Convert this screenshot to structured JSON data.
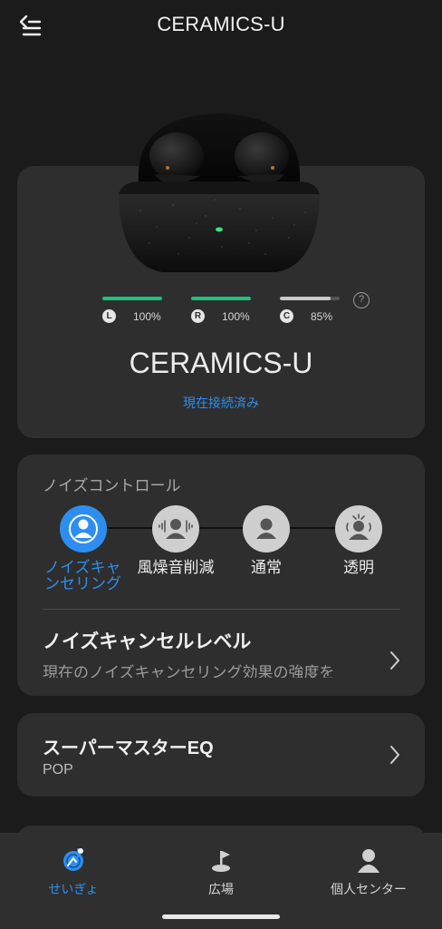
{
  "header": {
    "title": "CERAMICS-U",
    "back_icon": "menu-back-icon"
  },
  "device": {
    "name": "CERAMICS-U",
    "status": "現在接続済み",
    "battery": [
      {
        "badge": "L",
        "percent_label": "100%",
        "level": 1.0,
        "color": "#1fc17a"
      },
      {
        "badge": "R",
        "percent_label": "100%",
        "level": 1.0,
        "color": "#1fc17a"
      },
      {
        "badge": "C",
        "percent_label": "85%",
        "level": 0.85,
        "color": "#c8c8c8"
      }
    ],
    "help_label": "?"
  },
  "noise_control": {
    "title": "ノイズコントロール",
    "modes": [
      {
        "label": "ノイズキャンセリング",
        "icon": "noise-cancel-icon",
        "active": true
      },
      {
        "label": "風燥音削減",
        "icon": "wind-reduction-icon",
        "active": false
      },
      {
        "label": "通常",
        "icon": "normal-icon",
        "active": false
      },
      {
        "label": "透明",
        "icon": "transparency-icon",
        "active": false
      }
    ],
    "level_title": "ノイズキャンセルレベル",
    "level_desc": "現在のノイズキャンセリング効果の強度を"
  },
  "eq": {
    "title": "スーパーマスターEQ",
    "value": "POP"
  },
  "nav": {
    "items": [
      {
        "label": "せいぎょ",
        "icon": "control-icon",
        "active": true
      },
      {
        "label": "広場",
        "icon": "plaza-icon",
        "active": false
      },
      {
        "label": "個人センター",
        "icon": "profile-icon",
        "active": false
      }
    ]
  },
  "colors": {
    "accent": "#2e8ef0",
    "card": "#2e2e2e",
    "background": "#1b1b1b",
    "battery_full": "#1fc17a"
  }
}
